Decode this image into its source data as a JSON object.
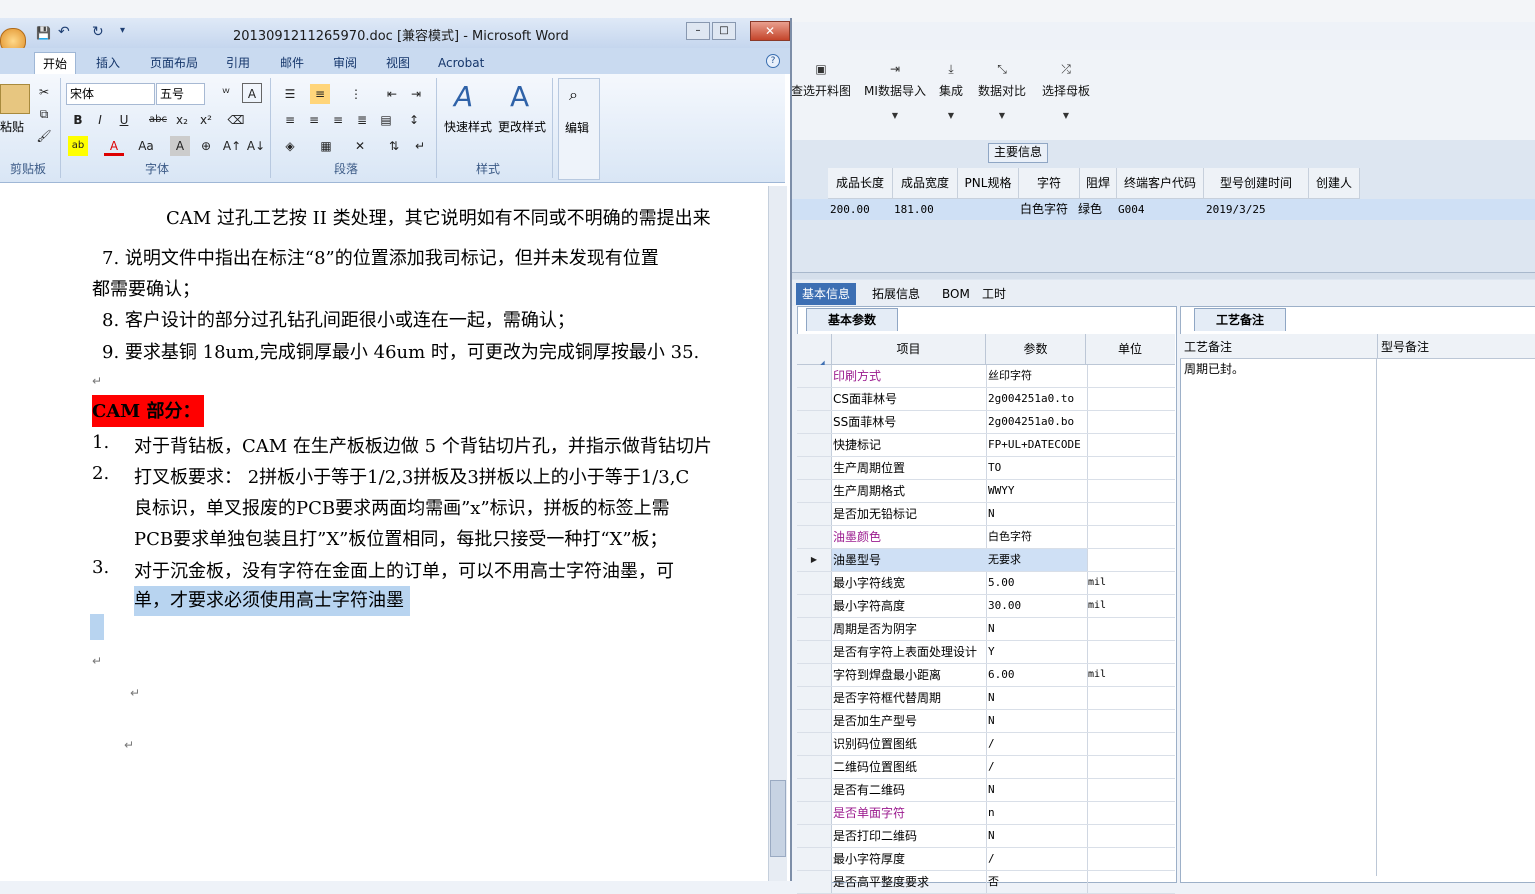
{
  "word": {
    "title": "2013091211265970.doc [兼容模式] - Microsoft Word",
    "tabs": [
      "开始",
      "插入",
      "页面布局",
      "引用",
      "邮件",
      "审阅",
      "视图",
      "Acrobat"
    ],
    "font_name": "宋体",
    "font_size": "五号",
    "groups": {
      "clipboard": "剪贴板",
      "font": "字体",
      "paragraph": "段落",
      "styles": "样式",
      "editing": "编辑"
    },
    "buttons": {
      "paste": "粘贴",
      "quick_styles": "快速样式",
      "change_styles": "更改样式",
      "edit": "编辑"
    },
    "doc_lines": {
      "l1": "CAM 过孔工艺按 II 类处理，其它说明如有不同或不明确的需提出来",
      "l2": "7.  说明文件中指出在标注“8”的位置添加我司标记，但并未发现有位置",
      "l3": "都需要确认；",
      "l4": "8.  客户设计的部分过孔钻孔间距很小或连在一起，需确认；",
      "l5": "9.  要求基铜 18um,完成铜厚最小 46um 时，可更改为完成铜厚按最小 35.",
      "cam_heading": "CAM 部分：",
      "n1": "1.",
      "i1": "对于背钻板，CAM 在生产板板边做 5 个背钻切片孔，并指示做背钻切片",
      "n2": "2.",
      "i2a": "打叉板要求： 2拼板小于等于1/2,3拼板及3拼板以上的小于等于1/3,C",
      "i2b": "良标识，单叉报废的PCB要求两面均需画”x”标识，拼板的标签上需",
      "i2c": "PCB要求单独包装且打”X”板位置相同，每批只接受一种打“X”板；",
      "n3": "3.",
      "i3a": "对于沉金板，没有字符在金面上的订单，可以不用高士字符油墨，可",
      "i3b": "单，才要求必须使用高士字符油墨"
    }
  },
  "app": {
    "toolbar": [
      {
        "label": "查选开料图",
        "icon": "image-icon"
      },
      {
        "label": "MI数据导入",
        "icon": "import-icon"
      },
      {
        "label": "集成",
        "icon": "download-icon"
      },
      {
        "label": "数据对比",
        "icon": "compare-icon"
      },
      {
        "label": "选择母板",
        "icon": "shuffle-icon"
      }
    ],
    "main_info_title": "主要信息",
    "grid_headers": [
      "成品长度",
      "成品宽度",
      "PNL规格",
      "字符",
      "阻焊",
      "终端客户代码",
      "型号创建时间",
      "创建人"
    ],
    "grid_row": [
      "200.00",
      "181.00",
      "",
      "白色字符",
      "绿色",
      "G004",
      "2019/3/25",
      ""
    ],
    "tabs": [
      "基本信息",
      "拓展信息",
      "BOM",
      "工时"
    ],
    "left_tab": "基本参数",
    "right_tab": "工艺备注",
    "param_headers": [
      "项目",
      "参数",
      "单位"
    ],
    "params": [
      {
        "item": "印刷方式",
        "value": "丝印字符",
        "unit": ""
      },
      {
        "item": "CS面菲林号",
        "value": "2g004251a0.to",
        "unit": ""
      },
      {
        "item": "SS面菲林号",
        "value": "2g004251a0.bo",
        "unit": ""
      },
      {
        "item": "快捷标记",
        "value": "FP+UL+DATECODE",
        "unit": ""
      },
      {
        "item": "生产周期位置",
        "value": "TO",
        "unit": ""
      },
      {
        "item": "生产周期格式",
        "value": "WWYY",
        "unit": ""
      },
      {
        "item": "是否加无铅标记",
        "value": "N",
        "unit": ""
      },
      {
        "item": "油墨颜色",
        "value": "白色字符",
        "unit": ""
      },
      {
        "item": "油墨型号",
        "value": "无要求",
        "unit": ""
      },
      {
        "item": "最小字符线宽",
        "value": "5.00",
        "unit": "mil"
      },
      {
        "item": "最小字符高度",
        "value": "30.00",
        "unit": "mil"
      },
      {
        "item": "周期是否为阴字",
        "value": "N",
        "unit": ""
      },
      {
        "item": "是否有字符上表面处理设计",
        "value": "Y",
        "unit": ""
      },
      {
        "item": "字符到焊盘最小距离",
        "value": "6.00",
        "unit": "mil"
      },
      {
        "item": "是否字符框代替周期",
        "value": "N",
        "unit": ""
      },
      {
        "item": "是否加生产型号",
        "value": "N",
        "unit": ""
      },
      {
        "item": "识别码位置图纸",
        "value": "/",
        "unit": ""
      },
      {
        "item": "二维码位置图纸",
        "value": "/",
        "unit": ""
      },
      {
        "item": "是否有二维码",
        "value": "N",
        "unit": ""
      },
      {
        "item": "是否单面字符",
        "value": "n",
        "unit": ""
      },
      {
        "item": "是否打印二维码",
        "value": "N",
        "unit": ""
      },
      {
        "item": "最小字符厚度",
        "value": "/",
        "unit": ""
      },
      {
        "item": "是否高平整度要求",
        "value": "否",
        "unit": ""
      }
    ],
    "remark_headers": [
      "工艺备注",
      "型号备注"
    ],
    "remark_text": "周期已封。"
  },
  "colors": {
    "highlight_red": "#ff0000",
    "selection": "#cfe0f5",
    "purple_text": "#9b1b8f",
    "accent_tab": "#3d6fb3"
  }
}
